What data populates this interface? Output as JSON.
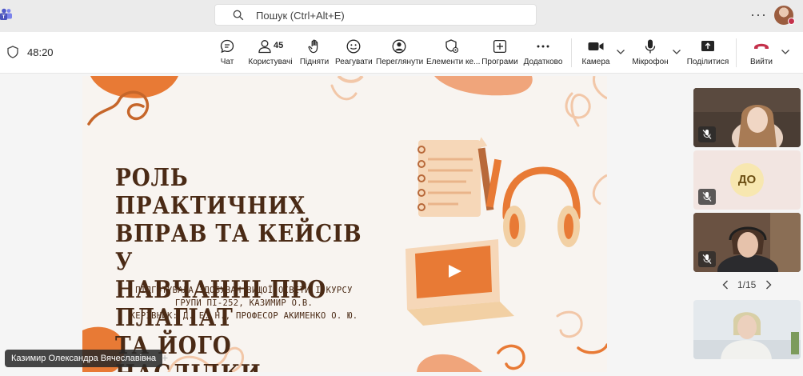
{
  "search": {
    "placeholder": "Пошук (Ctrl+Alt+E)",
    "icon": "search-icon"
  },
  "titlebar": {
    "more_icon": "more-icon"
  },
  "meeting": {
    "timer": "48:20"
  },
  "toolbar": {
    "chat_label": "Чат",
    "people_label": "Користувачі",
    "people_count": "45",
    "raise_label": "Підняти",
    "react_label": "Реагувати",
    "view_label": "Переглянути",
    "apps_elements_label": "Елементи ке...",
    "apps_label": "Програми",
    "more_label": "Додатково",
    "camera_label": "Камера",
    "mic_label": "Мікрофон",
    "share_label": "Поділитися",
    "leave_label": "Вийти",
    "colors": {
      "leave": "#c4314b",
      "accent": "#5b5fc7"
    }
  },
  "slide": {
    "title_lines": [
      "РОЛЬ ПРАКТИЧНИХ",
      "ВПРАВ ТА КЕЙСІВ У",
      "НАВЧАННІ ПРО ПЛАГІАТ",
      "ТА ЙОГО НАСЛІДКИ"
    ],
    "subtitle_lines": [
      "ПІДГОТУВАЛА ЗДОБУВАЧ ВИЩОЇ ОСВІТИ І КУРСУ",
      "ГРУПИ ПІ-252, КАЗИМИР О.В.",
      "КЕРІВНИК: Д. Е. Н., ПРОФЕСОР АКИМЕНКО О. Ю."
    ],
    "colors": {
      "background": "#f8f4f0",
      "accent": "#e87a35",
      "text": "#4a2a15",
      "pale": "#f4cdb0"
    }
  },
  "presenter": {
    "name": "Казимир Олександра Вячеславівна",
    "minimize": "—",
    "expand": "+"
  },
  "participants": {
    "tiles": [
      {
        "kind": "video",
        "muted": true
      },
      {
        "kind": "initials",
        "initials": "ДО",
        "muted": true
      },
      {
        "kind": "video",
        "muted": true
      },
      {
        "kind": "video",
        "muted": false
      }
    ],
    "pager": {
      "prev": "‹",
      "page": "1/15",
      "next": "›"
    }
  }
}
